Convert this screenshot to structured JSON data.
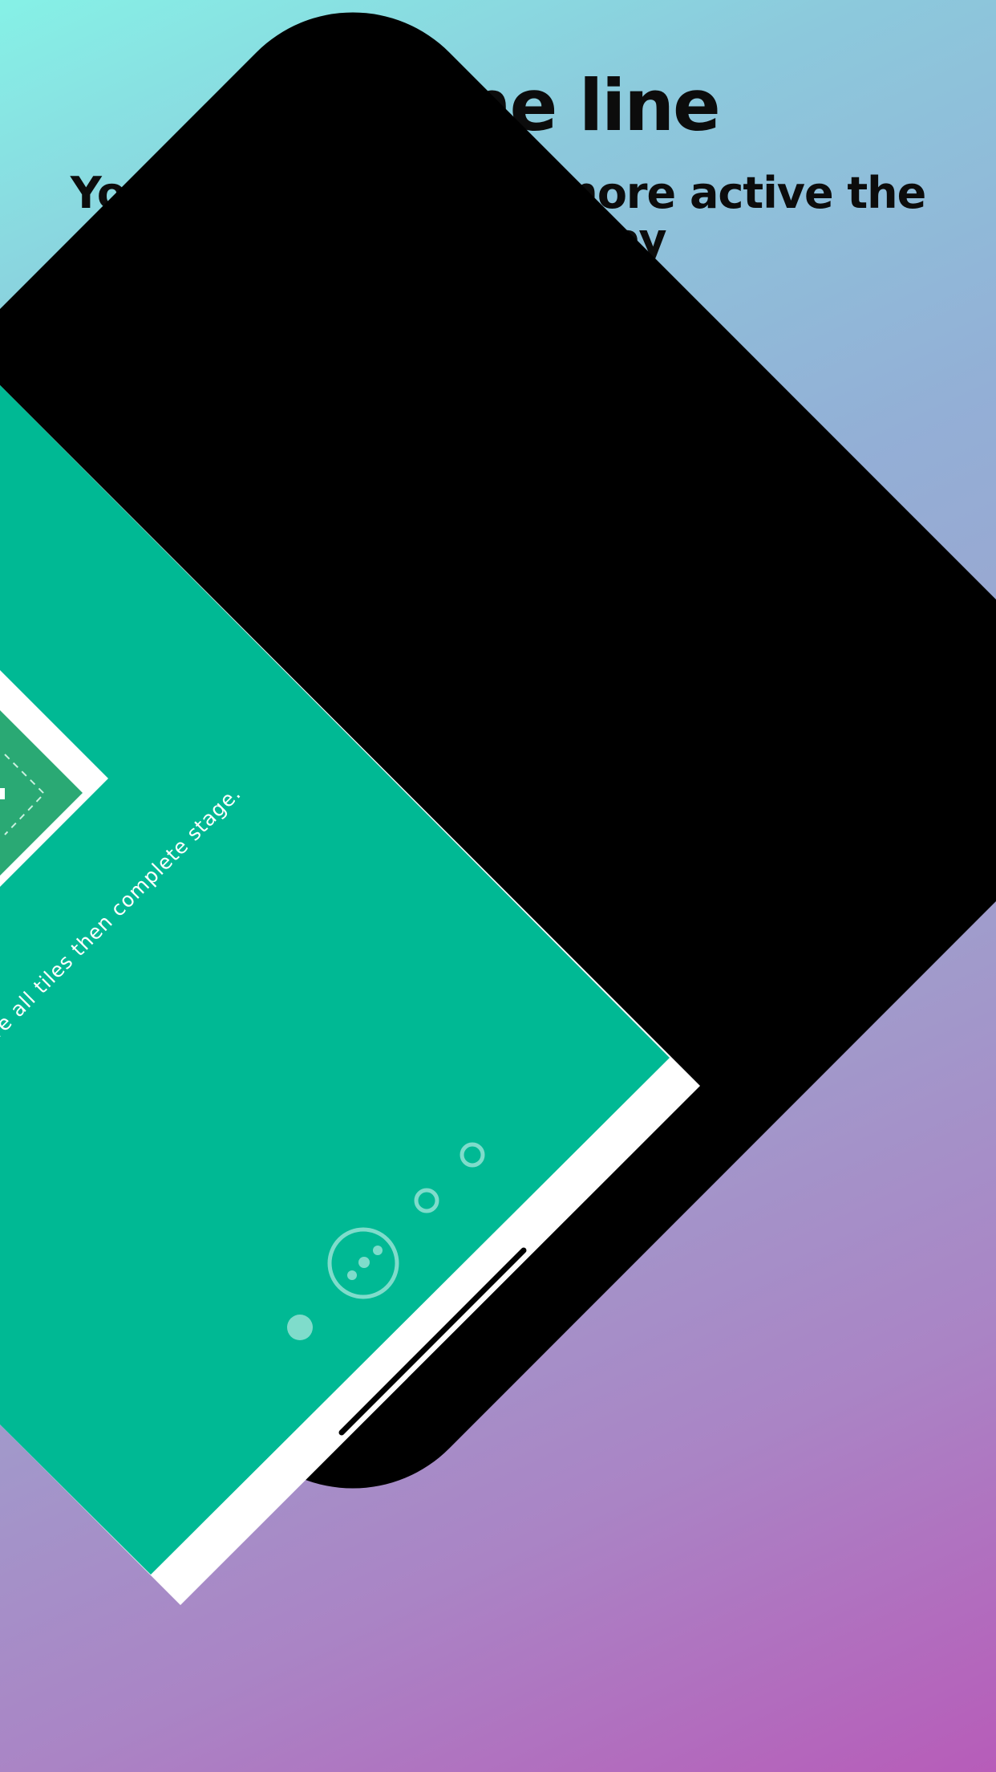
{
  "header": {
    "title": "Fill one line",
    "subtitle": "Your brain becomes more active the more you play"
  },
  "game": {
    "instruction": "Touch and drag your finger to move all tiles then complete stage."
  },
  "colors": {
    "background_start": "#86f1e6",
    "background_end": "#b75cb9",
    "device_body": "#000000",
    "screen": "#00b994",
    "tile_dark": "#2aa974",
    "page_indicator": "#7fdccb"
  },
  "icons": {
    "menu_dots": "three-dots-icon",
    "page_dots": "circle-outline"
  }
}
